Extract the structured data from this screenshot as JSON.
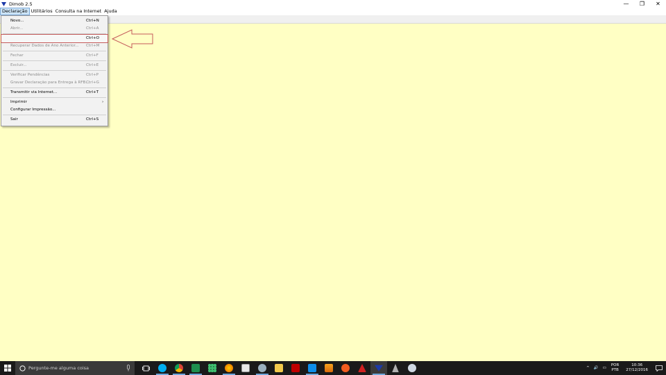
{
  "window": {
    "title": "Dimob 2.5",
    "controls": {
      "minimize": "—",
      "restore": "❐",
      "close": "✕"
    }
  },
  "menubar": {
    "items": [
      "Declaração",
      "Utilitários",
      "Consulta na Internet",
      "Ajuda"
    ]
  },
  "dropdown": {
    "items": [
      {
        "label": "Novo...",
        "shortcut": "Ctrl+N",
        "enabled": true
      },
      {
        "label": "Abrir...",
        "shortcut": "Ctrl+A",
        "enabled": false
      },
      {
        "label": "",
        "shortcut": "Ctrl+O",
        "enabled": true,
        "highlighted": true
      },
      {
        "label": "Recuperar Dados de Ano Anterior...",
        "shortcut": "Ctrl+M",
        "enabled": false
      },
      {
        "label": "Fechar",
        "shortcut": "Ctrl+F",
        "enabled": false
      },
      {
        "label": "Excluir...",
        "shortcut": "Ctrl+E",
        "enabled": false
      },
      {
        "label": "Verificar Pendências",
        "shortcut": "Ctrl+P",
        "enabled": false
      },
      {
        "label": "Gravar Declaração para Entrega à RFB...",
        "shortcut": "Ctrl+G",
        "enabled": false
      },
      {
        "label": "Transmitir via Internet...",
        "shortcut": "Ctrl+T",
        "enabled": true
      },
      {
        "label": "Imprimir",
        "shortcut": "",
        "enabled": true,
        "submenu": "›"
      },
      {
        "label": "Configurar Impressão...",
        "shortcut": "",
        "enabled": true
      },
      {
        "label": "Sair",
        "shortcut": "Ctrl+S",
        "enabled": true
      }
    ]
  },
  "taskbar": {
    "search_placeholder": "Pergunte-me alguma coisa",
    "language_top": "POR",
    "language_bottom": "PTB",
    "time": "10:36",
    "date": "27/12/2016"
  },
  "colors": {
    "client_bg": "#ffffc4",
    "highlight_border": "#c45a5a",
    "taskbar_bg": "#1a1a1a"
  }
}
